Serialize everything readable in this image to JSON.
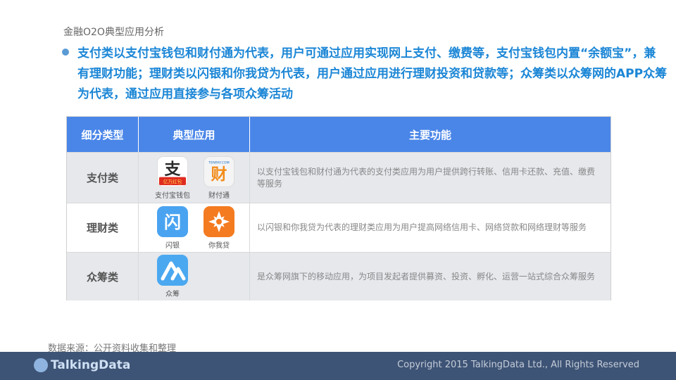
{
  "header": {
    "title": "金融O2O典型应用分析"
  },
  "bullet": {
    "text": "支付类以支付宝钱包和财付通为代表，用户可通过应用实现网上支付、缴费等，支付宝钱包内置“余额宝”，兼有理财功能；理财类以闪银和你我贷为代表，用户通过应用进行理财投资和贷款等；众筹类以众筹网的APP众筹为代表，通过应用直接参与各项众筹活动"
  },
  "table": {
    "headers": [
      "细分类型",
      "典型应用",
      "主要功能"
    ],
    "rows": [
      {
        "category": "支付类",
        "apps": [
          {
            "label": "支付宝钱包",
            "glyph": "支",
            "sub": "亿万红包"
          },
          {
            "label": "财付通",
            "glyph": "财",
            "sub": "TENPAY.COM"
          }
        ],
        "function": "以支付宝钱包和财付通为代表的支付类应用为用户提供跨行转账、信用卡还款、充值、缴费等服务"
      },
      {
        "category": "理财类",
        "apps": [
          {
            "label": "闪银",
            "glyph": "闪"
          },
          {
            "label": "你我贷",
            "glyph": ""
          }
        ],
        "function": "以闪银和你我贷为代表的理财类应用为用户提高网络信用卡、网络贷款和网络理财等服务"
      },
      {
        "category": "众筹类",
        "apps": [
          {
            "label": "众筹",
            "glyph": ""
          }
        ],
        "function": "是众筹网旗下的移动应用，为项目发起者提供募资、投资、孵化、运营一站式综合众筹服务"
      }
    ]
  },
  "footer": {
    "source": "数据来源：公开资料收集和整理",
    "logo": "TalkingData",
    "copyright": "Copyright 2015 TalkingData Ltd., All Rights Reserved"
  },
  "colors": {
    "accent": "#1b86d6",
    "table_header": "#4a86e8",
    "footer_bar": "#3e5476"
  }
}
